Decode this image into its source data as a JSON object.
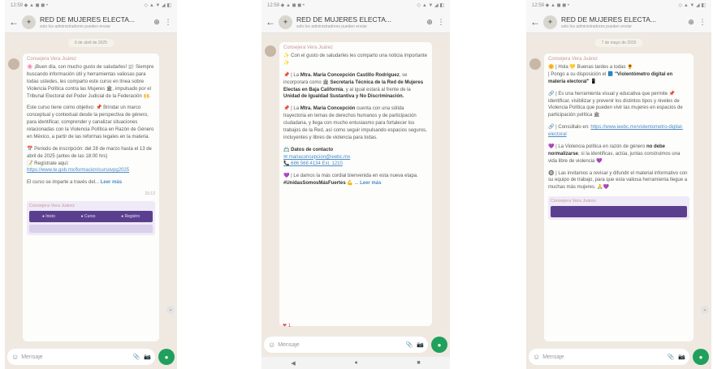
{
  "status": {
    "left": "12:59 ◆ ▲ ◼ ◼ •",
    "right": "◇ ▲ ▼ ◢ ◧"
  },
  "group": {
    "name": "RED DE MUJERES ELECTA...",
    "subtitle": "solo los administradores pueden enviar"
  },
  "input": {
    "placeholder": "Mensaje"
  },
  "phones": [
    {
      "date": "6 de abril de 2025",
      "sender": "Consejera Vera Juárez",
      "paragraphs": [
        "🌸 ¡Buen día, con mucho gusto de saludarles! 📰 Siempre buscando información útil y herramientas valiosas para todas ustedes, les comparto este curso en línea sobre Violencia Política contra las Mujeres 🏛, impulsado por el Tribunal Electoral del Poder Judicial de la Federación 🙌.",
        "Este curso tiene como objetivo: 📌 Brindar un marco conceptual y contextual desde la perspectiva de género, para identificar, comprender y canalizar situaciones relacionadas con la Violencia Política en Razón de Género en México, a partir de las reformas legales en la materia.",
        "📅 Periodo de inscripción: del 28 de marzo hasta el 13 de abril de 2025 (antes de las 18:00 hrs)"
      ],
      "register_label": "📝 Regístrate aquí:",
      "register_link": "https://www.te.gob.mx/formacion/cursovpg2025",
      "closing_text": "El curso se imparte a través del...",
      "read_more": "Leer más",
      "time": "10:13",
      "card_sender": "Consejera Vera Juárez",
      "card_buttons": [
        "● Inicio",
        "● Curso",
        "● Registro"
      ]
    },
    {
      "sender": "Consejera Vera Juárez",
      "paragraphs": [
        "✨ Con el gusto de saludarles les comparto una noticia importante ✨"
      ],
      "p2_prefix": "📌 | La ",
      "p2_bold": "Mtra. María Concepción Castillo Rodríguez",
      "p2_mid": ", se incorporará como 🏛 ",
      "p2_bold2": "Secretaria Técnica de la Red de Mujeres Electas en Baja California",
      "p2_mid2": ", y al igual estará al frente de la ",
      "p2_bold3": "Unidad de Igualdad Sustantiva y No Discriminación.",
      "p3_prefix": "📌 | La ",
      "p3_bold": "Mtra. María Concepción",
      "p3_rest": " cuenta con una sólida trayectoria en temas de derechos humanos y de participación ciudadana, y llega con mucho entusiasmo para fortalecer los trabajos de la Red, así como seguir impulsando espacios seguros, incluyentes y libres de violencia para todas.",
      "contact_title": "📇 Datos de contacto",
      "contact_email": "✉ mariaconcepcion@ieebc.mx",
      "contact_phone": "📞 686 568 4134 Ext. 1210",
      "closing_prefix": "💜 | Le damos la más cordial bienvenida en esta nueva etapa. ",
      "closing_tag": "#UnidasSomosMásFuertes",
      "closing_suffix": " 💪 ...",
      "read_more": "Leer más",
      "reaction": "❤ 1"
    },
    {
      "date": "7 de mayo de 2025",
      "sender": "Consejera Vera Juárez",
      "line1": "🌼 | Hola 💛 Buenas tardes a todas 🌻",
      "line2_prefix": "| Pongo a su disposición el 📘 ",
      "line2_bold": "\"Violentómetro digital en materia electoral\"",
      "line2_suffix": " 📱",
      "p2": "🔗 | Es una herramienta visual y educativa que permite 📌 identificar, visibilizar y prevenir los distintos tipos y niveles de Violencia Política que pueden vivir las mujeres en espacios de participación política 🏛",
      "consult_label": "🔗 | Consúltalo en: ",
      "consult_link": "https://www.ieebc.mx/violentometro-digital-electoral",
      "p4_prefix": "💜 | La Violencia política en razón de género ",
      "p4_bold": "no debe normalizarse",
      "p4_rest": ", si la identificas, actúa, juntas construimos una vida libre de violencia 💜",
      "p5": "🔘 | Las invitamos a revisar y difundir el material informativo con su equipo de trabajo, para que esta valiosa herramienta llegue a muchas más mujeres. 🙏💜",
      "card_sender": "Consejera Vera Juárez"
    }
  ]
}
